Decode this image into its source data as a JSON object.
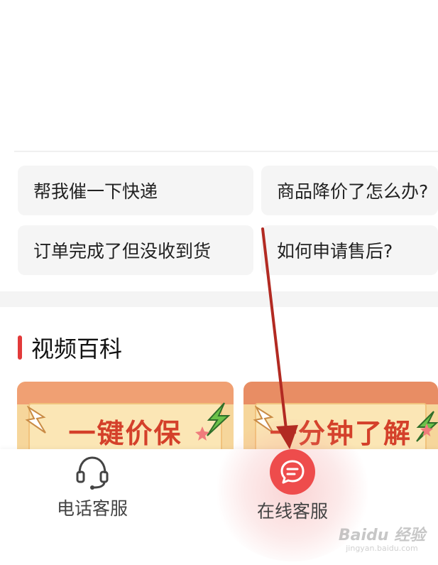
{
  "quick_questions": [
    "帮我催一下快递",
    "商品降价了怎么办?",
    "订单完成了但没收到货",
    "如何申请售后?"
  ],
  "video_section": {
    "title": "视频百科",
    "cards": [
      {
        "text": "一键价保"
      },
      {
        "text": "一分钟了解"
      }
    ]
  },
  "bottom_nav": {
    "phone_label": "电话客服",
    "online_label": "在线客服",
    "phone_icon": "headset-icon",
    "online_icon": "chat-bubble-icon"
  },
  "watermark": {
    "main": "Baidu 经验",
    "sub": "jingyan.baidu.com"
  },
  "colors": {
    "accent": "#ee4c4c",
    "annotation_arrow": "#b22a22"
  }
}
